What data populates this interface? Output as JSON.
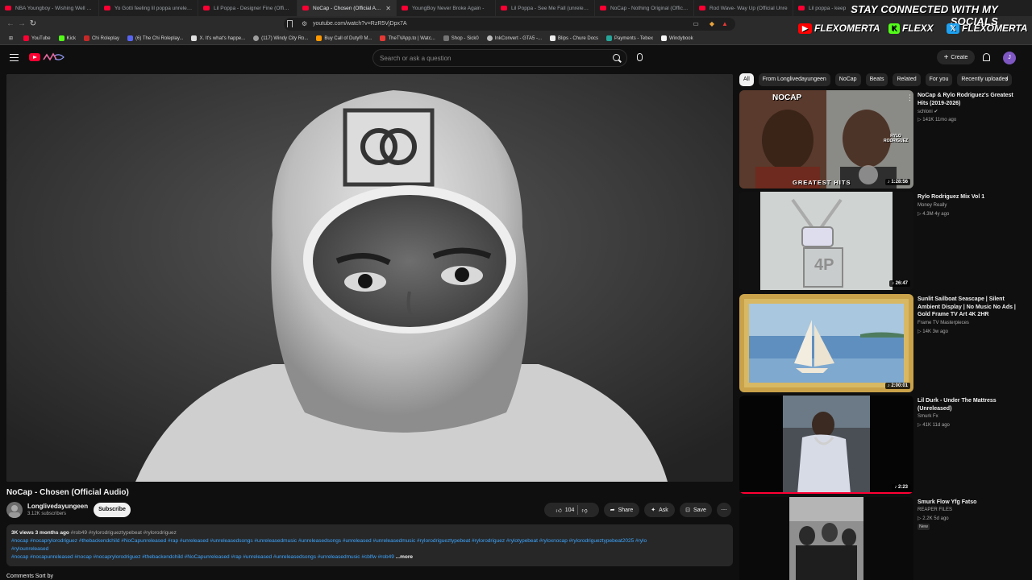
{
  "browser": {
    "tabs": [
      {
        "label": "NBA Youngboy - Wishing Well (Time",
        "active": false
      },
      {
        "label": "Yo Gotti feeling lil poppa unreleased",
        "active": false
      },
      {
        "label": "Lil Poppa - Designer Fine (Official M",
        "active": false
      },
      {
        "label": "NoCap - Chosen (Official Audio)",
        "active": true
      },
      {
        "label": "YoungBoy Never Broke Again -",
        "active": false
      },
      {
        "label": "Lil Poppa - See Me Fall (unreleased",
        "active": false
      },
      {
        "label": "NoCap - Nothing Original (Official A",
        "active": false
      },
      {
        "label": "Rod Wave- Way Up (Official Unre",
        "active": false
      },
      {
        "label": "Lil poppa - keep",
        "active": false
      }
    ],
    "url": "youtube.com/watch?v=RzR5VjDpx7A",
    "bookmarks": [
      {
        "label": "YouTube",
        "color": "#ff0033"
      },
      {
        "label": "Kick",
        "color": "#53fc18"
      },
      {
        "label": "Chi Roleplay",
        "color": "#c62828"
      },
      {
        "label": "(6) The Chi Roleplay...",
        "color": "#5865f2"
      },
      {
        "label": "X. It's what's happe...",
        "color": "#e0e0e0"
      },
      {
        "label": "(117) Windy City Ro...",
        "color": "#9e9e9e"
      },
      {
        "label": "Buy Call of Duty® M...",
        "color": "#ff9800"
      },
      {
        "label": "TheTVApp.to | Watc...",
        "color": "#e53935"
      },
      {
        "label": "Shop - Sick0",
        "color": "#757575"
      },
      {
        "label": "InkConvert - GTA5 -...",
        "color": "#bdbdbd"
      },
      {
        "label": "Blips - Chure Docs",
        "color": "#eeeeee"
      },
      {
        "label": "Payments - Tebex",
        "color": "#26a69a"
      },
      {
        "label": "Windybook",
        "color": "#f5f5f5"
      }
    ]
  },
  "overlay": {
    "title": "STAY CONNECTED WITH MY SOCIALS",
    "socials": [
      {
        "label": "FLEXOMERTA",
        "icon": "youtube-icon",
        "color": "#ff0000"
      },
      {
        "label": "FLEXX",
        "icon": "kick-icon",
        "color": "#53fc18"
      },
      {
        "label": "FLEXOMERTA",
        "icon": "x-icon",
        "color": "#1da1f2"
      }
    ]
  },
  "youtube": {
    "search_placeholder": "Search or ask a question",
    "create_label": "Create",
    "avatar_letter": "J"
  },
  "video": {
    "title": "NoCap - Chosen (Official Audio)",
    "channel": "Longlivedayungeen",
    "subscribers": "3.12K subscribers",
    "subscribe_label": "Subscribe",
    "likes": "104",
    "share_label": "Share",
    "ask_label": "Ask",
    "save_label": "Save",
    "description": {
      "meta": "3K views  3 months ago",
      "line1_tags": "#rob49 #rylorodrigueztypebeat #rylorodriguez",
      "line2": "#nocap #nocaprylorodriguez #thebackendchild #NoCapunreleased #rap #unreleased #unreleasedsongs #unreleasedmusic #unreleasedsongs #unreleased #unreleasedmusic #rylorodrigueztypebeat #rylorodriguez #rylotypebeat #ryloxnocap #rylorodrigueztypebeat2025 #rylo",
      "line3": "#rylounreleased",
      "line4": "#nocap #nocapunreleased #nocap #nocaprylorodriguez #thebackendchild #NoCapunreleased #rap #unreleased #unreleasedsongs #unreleasedmusic #cblfw #rob49",
      "more": "...more"
    },
    "comments_partial": "Comments  Sort by"
  },
  "chips": [
    "All",
    "From Longlivedayungeen",
    "NoCap",
    "Beats",
    "Related",
    "For you",
    "Recently uploaded"
  ],
  "recommendations": [
    {
      "title": "NoCap & Rylo Rodriguez's Greatest Hits (2019-2026)",
      "channel": "schloni",
      "verified": true,
      "meta": "141K  11mo ago",
      "duration": "1:28:56",
      "badge": "",
      "thumb_text": "NOCAP",
      "thumb_text2": "GREATEST HITS",
      "thumb_text3": "RYLO RODRIGUEZ"
    },
    {
      "title": "Rylo Rodriguez Mix Vol 1",
      "channel": "Money Really",
      "verified": false,
      "meta": "4.3M  4y ago",
      "duration": "26:47",
      "badge": "",
      "thumb_text": "4P"
    },
    {
      "title": "Sunlit Sailboat Seascape | Silent Ambient Display | No Music No Ads | Gold Frame TV Art 4K 2HR",
      "channel": "Frame TV Masterpieces",
      "verified": false,
      "meta": "14K  3w ago",
      "duration": "2:00:01",
      "badge": ""
    },
    {
      "title": "Lil Durk - Under The Mattress (Unreleased)",
      "channel": "Smurk Fx",
      "verified": false,
      "meta": "41K  11d ago",
      "duration": "2:23",
      "badge": ""
    },
    {
      "title": "Smurk Flow Yfg Fatso",
      "channel": "REAPER FILES",
      "verified": false,
      "meta": "2.2K  5d ago",
      "duration": "",
      "badge": "New"
    }
  ]
}
